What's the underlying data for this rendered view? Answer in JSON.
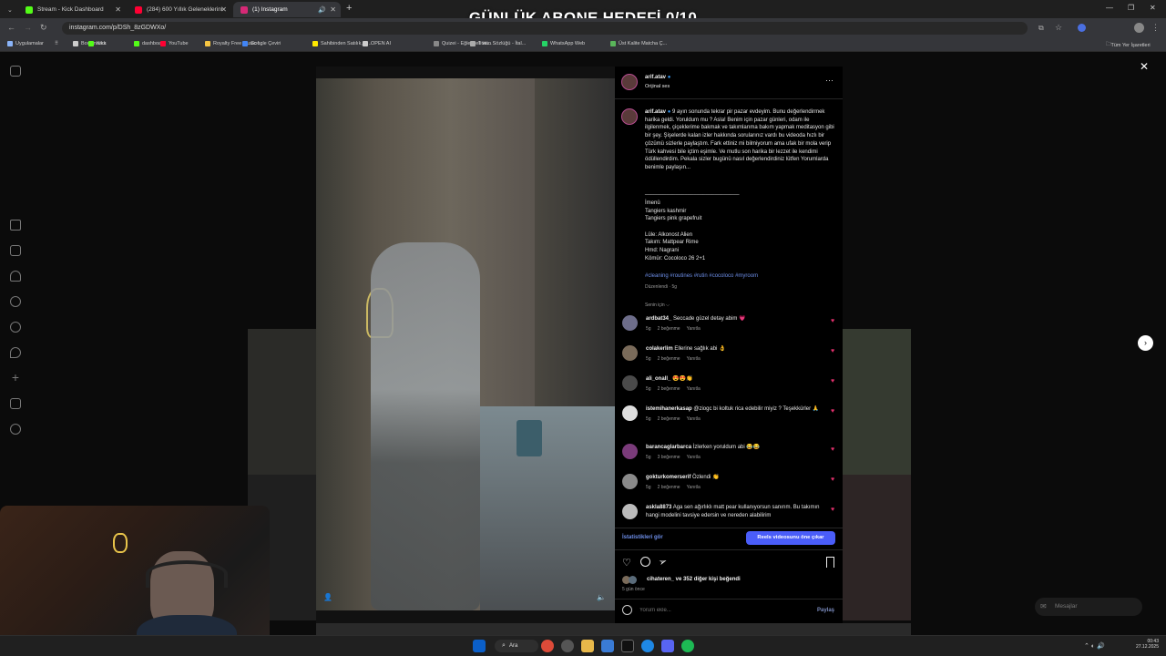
{
  "stream_overlay": {
    "title": "GÜNLÜK ABONE HEDEFİ 0/10"
  },
  "browser": {
    "tabs": [
      {
        "label": "Stream - Kick Dashboard",
        "color": "#53fc18"
      },
      {
        "label": "(284) 600 Yıllık Geleneklerini S...",
        "color": "#ff0033"
      },
      {
        "label": "(1) Instagram",
        "color": "#d62976"
      }
    ],
    "url": "instagram.com/p/DSh_8zGDWXo/",
    "bookmarks": [
      {
        "label": "Uygulamalar",
        "color": "#8ab4f8"
      },
      {
        "label": "Bookmarks",
        "color": "#cccccc"
      },
      {
        "label": "Kick",
        "color": "#53fc18"
      },
      {
        "label": "dashboard",
        "color": "#53fc18"
      },
      {
        "label": "YouTube",
        "color": "#ff0033"
      },
      {
        "label": "Royalty Free Music f...",
        "color": "#f5c542"
      },
      {
        "label": "Google Çeviri",
        "color": "#4285f4"
      },
      {
        "label": "Sahibinden Satılık, K...",
        "color": "#ffe800"
      },
      {
        "label": "OPEN AI",
        "color": "#cccccc"
      },
      {
        "label": "Quizei - Eğlenceli ve...",
        "color": "#888888"
      },
      {
        "label": "Tütün Sözlüğü - İtal...",
        "color": "#aaaaaa"
      },
      {
        "label": "WhatsApp Web",
        "color": "#25d366"
      },
      {
        "label": "Üst Kalite Matcha Ç...",
        "color": "#5ab55a"
      }
    ],
    "all_bookmarks": "Tüm Yer İşaretleri"
  },
  "post": {
    "author": "arif.atav",
    "audio": "Orijinal ses",
    "caption": "9 ayın sonunda tekrar pir pazar evdeyim. Bunu değerlendirmek harika geldi. Yoruldum mu ? Asla! Benim için pazar günleri, odam ile ilgilenmek, çiçeklerime bakmak ve takımlarıma bakım yapmak meditasyon gibi bir şey. Şişelerde kalan izler hakkında sorularınız vardı bu videoda hızlı bir çözümü sizlerle paylaştım. Fark ettiniz mi bilmiyorum ama ufak bir mola verip Türk kahvesi bile içtim eşimle. Ve mutlu son harika bir lezzet ile kendimi ödüllendirdim. Pekala sizler bugünü nasıl değerlendirdiniz lütfen Yorumlarda benimle paylaşın...",
    "divider": "_______________________________",
    "details": [
      "İmenü",
      "Tangiers kashmir",
      "Tangiers pink grapefruit",
      "",
      "Lüle: Alkonost Alien",
      "Takım: Mattpear Rime",
      "Hmd: Nagrani",
      "Kömür: Cocoloco 26 2+1"
    ],
    "hashtags": "#cleaning #routines #rutin #cocoloco #myroom",
    "edited": "Düzenlendi · 5g",
    "for_you": "Senin için ⌵",
    "comments": [
      {
        "user": "ardbat34_",
        "text": "Seccade güzel detay abim 💗",
        "age": "5g",
        "likes": "2 beğenme",
        "reply": "Yanıtla",
        "color": "#6d6d8a"
      },
      {
        "user": "colakerlim",
        "text": "Ellerine sağlık abi 👌",
        "age": "5g",
        "likes": "2 beğenme",
        "reply": "Yanıtla",
        "color": "#7a6b5a"
      },
      {
        "user": "ali_onall_",
        "text": "😍😍👏",
        "age": "5g",
        "likes": "2 beğenme",
        "reply": "Yanıtla",
        "color": "#4a4a4a"
      },
      {
        "user": "istemihanerkasap",
        "text": "@ziogc bi koltuk rica edebilir miyiz ? Teşekkürler 🙏",
        "age": "5g",
        "likes": "2 beğenme",
        "reply": "Yanıtla",
        "color": "#dddddd"
      },
      {
        "user": "barancaglarbarca",
        "text": "İzlerken yoruldum abi 😂😂",
        "age": "5g",
        "likes": "3 beğenme",
        "reply": "Yanıtla",
        "color": "#7a3b7a"
      },
      {
        "user": "gokturkomerserif",
        "text": "Özlendi 👏",
        "age": "5g",
        "likes": "2 beğenme",
        "reply": "Yanıtla",
        "color": "#8a8a8a"
      },
      {
        "user": "askla8873",
        "text": "Aga sen ağırlıklı matt pear kullanıyorsun sanırım. Bu takımın hangi modelini tavsiye edersin ve nereden alabilirim",
        "age": "",
        "likes": "",
        "reply": "",
        "color": "#bbbbbb"
      }
    ],
    "insights_link": "İstatistikleri gör",
    "boost_button": "Reels videosunu öne çıkar",
    "likes_summary": "cihateren_ ve 352 diğer kişi beğendi",
    "posted": "5 gün önce",
    "comment_placeholder": "Yorum ekle...",
    "share_button": "Paylaş"
  },
  "messages_button": "Mesajlar",
  "taskbar": {
    "search": "Ara",
    "clock_time": "00:43",
    "clock_date": "27.12.2025"
  },
  "colors": {
    "accent": "#4a5df9",
    "link": "#6d8ee8",
    "heart": "#e1306c",
    "bg": "#0b0b0b"
  }
}
